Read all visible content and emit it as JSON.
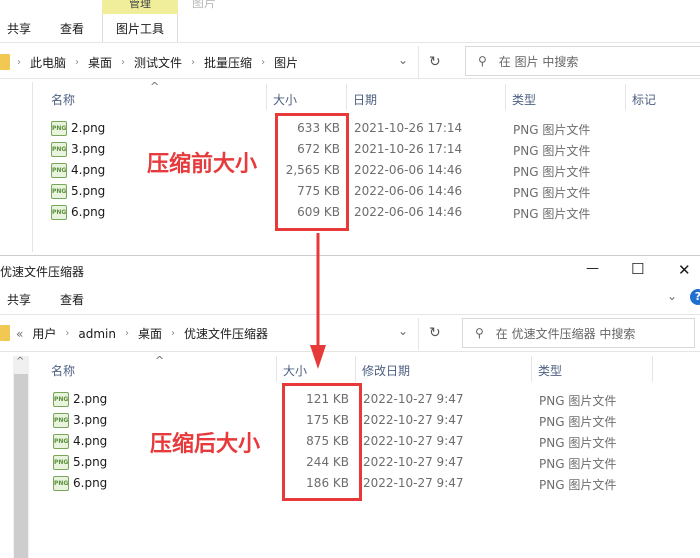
{
  "window1": {
    "title": "图片",
    "context_tab": "管理",
    "tabs": [
      "共享",
      "查看",
      "图片工具"
    ],
    "breadcrumb": [
      "此电脑",
      "桌面",
      "测试文件",
      "批量压缩",
      "图片"
    ],
    "search_placeholder": "在 图片 中搜索",
    "columns": [
      "名称",
      "大小",
      "日期",
      "类型",
      "标记"
    ],
    "files": [
      {
        "name": "2.png",
        "size": "633 KB",
        "date": "2021-10-26 17:14",
        "type": "PNG 图片文件"
      },
      {
        "name": "3.png",
        "size": "672 KB",
        "date": "2021-10-26 17:14",
        "type": "PNG 图片文件"
      },
      {
        "name": "4.png",
        "size": "2,565 KB",
        "date": "2022-06-06 14:46",
        "type": "PNG 图片文件"
      },
      {
        "name": "5.png",
        "size": "775 KB",
        "date": "2022-06-06 14:46",
        "type": "PNG 图片文件"
      },
      {
        "name": "6.png",
        "size": "609 KB",
        "date": "2022-06-06 14:46",
        "type": "PNG 图片文件"
      }
    ],
    "annotation": "压缩前大小"
  },
  "window2": {
    "title": "优速文件压缩器",
    "tabs": [
      "共享",
      "查看"
    ],
    "breadcrumb": [
      "«",
      "用户",
      "admin",
      "桌面",
      "优速文件压缩器"
    ],
    "search_placeholder": "在 优速文件压缩器 中搜索",
    "columns": [
      "名称",
      "大小",
      "修改日期",
      "类型"
    ],
    "files": [
      {
        "name": "2.png",
        "size": "121 KB",
        "date": "2022-10-27 9:47",
        "type": "PNG 图片文件"
      },
      {
        "name": "3.png",
        "size": "175 KB",
        "date": "2022-10-27 9:47",
        "type": "PNG 图片文件"
      },
      {
        "name": "4.png",
        "size": "875 KB",
        "date": "2022-10-27 9:47",
        "type": "PNG 图片文件"
      },
      {
        "name": "5.png",
        "size": "244 KB",
        "date": "2022-10-27 9:47",
        "type": "PNG 图片文件"
      },
      {
        "name": "6.png",
        "size": "186 KB",
        "date": "2022-10-27 9:47",
        "type": "PNG 图片文件"
      }
    ],
    "annotation": "压缩后大小"
  },
  "icons": {
    "png": "PNG",
    "minimize": "—",
    "maximize": "☐",
    "close": "✕",
    "help": "?",
    "refresh": "↻",
    "dropdown": "⌄",
    "search": "⚲",
    "sort": "^"
  }
}
